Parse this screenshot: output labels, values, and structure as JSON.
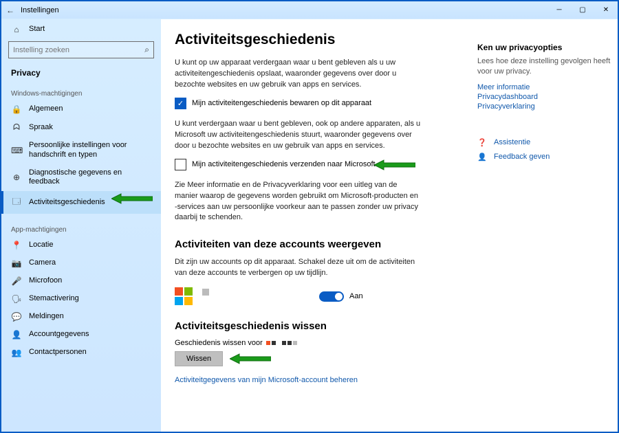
{
  "titlebar": {
    "title": "Instellingen"
  },
  "sidebar": {
    "home": "Start",
    "search_placeholder": "Instelling zoeken",
    "current": "Privacy",
    "group1": "Windows-machtigingen",
    "items1": [
      {
        "label": "Algemeen"
      },
      {
        "label": "Spraak"
      },
      {
        "label": "Persoonlijke instellingen voor handschrift en typen"
      },
      {
        "label": "Diagnostische gegevens en feedback"
      },
      {
        "label": "Activiteitsgeschiedenis"
      }
    ],
    "group2": "App-machtigingen",
    "items2": [
      {
        "label": "Locatie"
      },
      {
        "label": "Camera"
      },
      {
        "label": "Microfoon"
      },
      {
        "label": "Stemactivering"
      },
      {
        "label": "Meldingen"
      },
      {
        "label": "Accountgegevens"
      },
      {
        "label": "Contactpersonen"
      }
    ]
  },
  "main": {
    "heading": "Activiteitsgeschiedenis",
    "para1": "U kunt op uw apparaat verdergaan waar u bent gebleven als u uw activiteitengeschiedenis opslaat, waaronder gegevens over door u bezochte websites en uw gebruik van apps en services.",
    "check1": "Mijn activiteitengeschiedenis bewaren op dit apparaat",
    "para2": "U kunt verdergaan waar u bent gebleven, ook op andere apparaten, als u Microsoft uw activiteitengeschiedenis stuurt, waaronder gegevens over door u bezochte websites en uw gebruik van apps en services.",
    "check2": "Mijn activiteitengeschiedenis verzenden naar Microsoft",
    "para3": "Zie Meer informatie en de Privacyverklaring voor een uitleg van de manier waarop de gegevens worden gebruikt om Microsoft-producten en -services aan uw persoonlijke voorkeur aan te passen zonder uw privacy daarbij te schenden.",
    "heading2": "Activiteiten van deze accounts weergeven",
    "para4": "Dit zijn uw accounts op dit apparaat. Schakel deze uit om de activiteiten van deze accounts te verbergen op uw tijdlijn.",
    "toggle_state": "Aan",
    "heading3": "Activiteitsgeschiedenis wissen",
    "clear_for": "Geschiedenis wissen voor",
    "clear_btn": "Wissen",
    "manage_link": "Activiteitgegevens van mijn Microsoft-account beheren"
  },
  "right": {
    "head": "Ken uw privacyopties",
    "sub": "Lees hoe deze instelling gevolgen heeft voor uw privacy.",
    "links": [
      "Meer informatie",
      "Privacydashboard",
      "Privacyverklaring"
    ],
    "help1": "Assistentie",
    "help2": "Feedback geven"
  }
}
